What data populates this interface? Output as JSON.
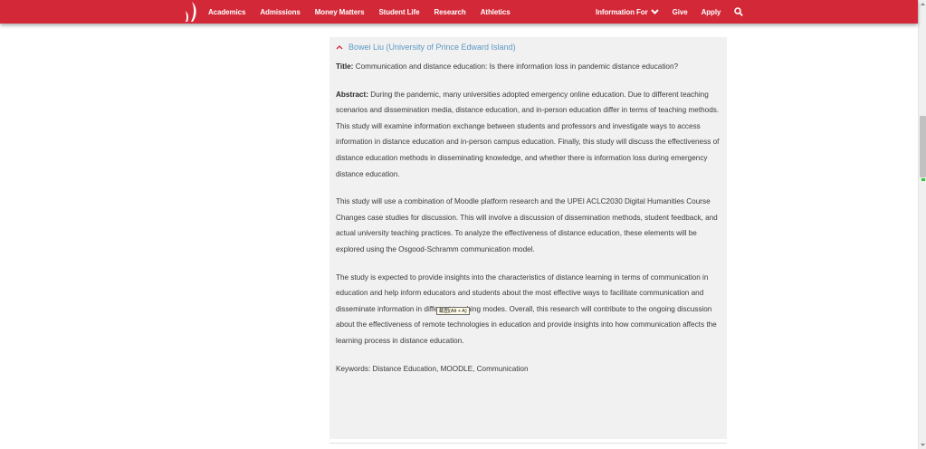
{
  "nav": {
    "left_items": [
      "Academics",
      "Admissions",
      "Money Matters",
      "Student Life",
      "Research",
      "Athletics"
    ],
    "information_for": "Information For",
    "give": "Give",
    "apply": "Apply"
  },
  "icons": {
    "logo": "sail-logo-icon",
    "search": "search-icon",
    "nav_chevron": "chevron-down-icon",
    "accordion_chevron": "chevron-up-icon"
  },
  "colors": {
    "nav_background": "#d32838",
    "accordion_title": "#5b98c4",
    "panel_background": "#f1f1f1"
  },
  "accordion": {
    "title": "Bowei Liu (University of Prince Edward Island)",
    "title_label": "Title:",
    "title_text": "Communication and distance education: Is there information loss in pandemic distance education?",
    "abstract_label": "Abstract:",
    "abstract_text": "During the pandemic, many universities adopted emergency online education. Due to different teaching scenarios and dissemination media, distance education, and in-person education differ in terms of teaching methods. This study will examine information exchange between students and professors and investigate ways to access information in distance education and in-person campus education. Finally, this study will discuss the effectiveness of distance education methods in disseminating knowledge, and whether there is information loss during emergency distance education.",
    "paragraph_2": "This study will use a combination of Moodle platform research and the UPEI ACLC2030 Digital Humanities Course Changes case studies for discussion. This will involve a discussion of dissemination methods, student feedback, and actual university teaching practices. To analyze the effectiveness of distance education, these elements will be explored using the Osgood-Schramm communication model.",
    "paragraph_3": "The study is expected to provide insights into the characteristics of distance learning in terms of communication in education and help inform educators and students about the most effective ways to facilitate communication and disseminate information in different teaching modes. Overall, this research will contribute to the ongoing discussion about the effectiveness of remote technologies in education and provide insights into how communication affects the learning process in distance education.",
    "keywords": "Keywords: Distance Education, MOODLE, Communication"
  },
  "tooltip": {
    "text": "截图(Alt + A)"
  }
}
